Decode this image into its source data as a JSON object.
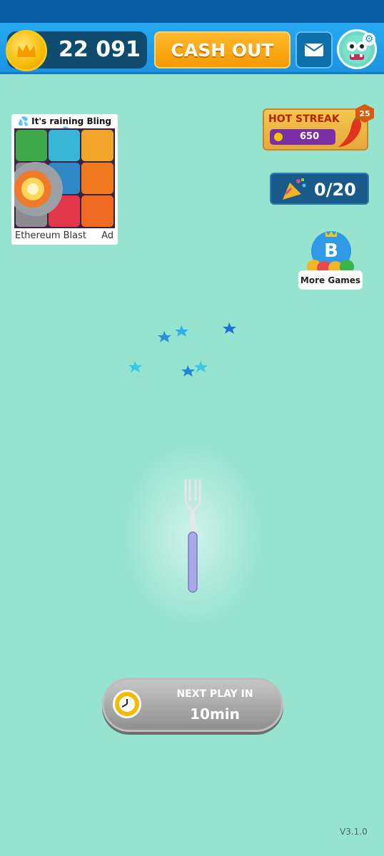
{
  "header": {
    "coin_balance": "22 091",
    "cashout_label": "CASH OUT",
    "icons": [
      "crown-coin-icon",
      "mail-icon",
      "avatar-icon",
      "gear-icon"
    ]
  },
  "ad": {
    "title": "💦 It's raining Bling 💦",
    "game_name": "Ethereum Blast",
    "tag": "Ad"
  },
  "hot_streak": {
    "label": "HOT STREAK",
    "value": "650",
    "badge": "25",
    "icon": "chili-pepper-icon"
  },
  "progress": {
    "value": "0/20",
    "icon": "party-popper-icon"
  },
  "more_games": {
    "label": "More Games",
    "badge_letter": "B"
  },
  "game": {
    "item": "fork-icon"
  },
  "next_play": {
    "label": "NEXT PLAY IN",
    "time": "10min",
    "icon": "clock-icon"
  },
  "version": "V3.1.0",
  "colors": {
    "background": "#96e3cf",
    "topbar": "#1b93e3",
    "cashout": "#f49a00",
    "coin": "#f6b800",
    "streak_purple": "#7b2fa5"
  }
}
